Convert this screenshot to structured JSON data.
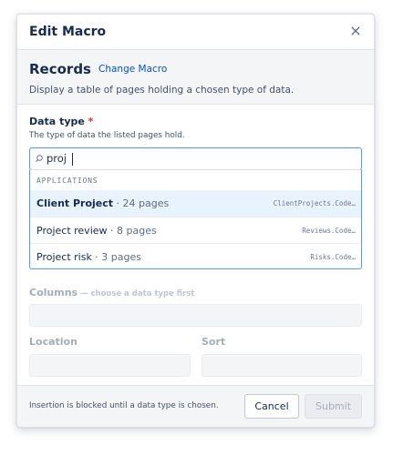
{
  "dialog": {
    "title": "Edit Macro",
    "close_glyph": "×"
  },
  "macro": {
    "name": "Records",
    "change_link": "Change Macro",
    "description": "Display a table of pages holding a chosen type of data."
  },
  "data_type": {
    "label": "Data type",
    "required_mark": "*",
    "help": "The type of data the listed pages hold.",
    "search_value": "proj",
    "search_icon": "magnifier-icon"
  },
  "dropdown": {
    "group_label": "APPLICATIONS",
    "items": [
      {
        "name": "Client Project",
        "count": " · 24 pages",
        "code": "ClientProjects.Code…",
        "selected": true
      },
      {
        "name": "Project review",
        "count": " · 8 pages",
        "code": "Reviews.Code…",
        "selected": false
      },
      {
        "name": "Project risk",
        "count": " · 3 pages",
        "code": "Risks.Code…",
        "selected": false
      }
    ]
  },
  "columns": {
    "label": "Columns",
    "hint": " — choose a data type first"
  },
  "location": {
    "label": "Location"
  },
  "sort": {
    "label": "Sort"
  },
  "footer": {
    "note": "Insertion is blocked until a data type is chosen.",
    "cancel_label": "Cancel",
    "submit_label": "Submit"
  },
  "colors": {
    "accent": "#0052cc",
    "focus_border": "#4c9aff",
    "required": "#de350b",
    "selected_row": "#e9f2ff"
  }
}
